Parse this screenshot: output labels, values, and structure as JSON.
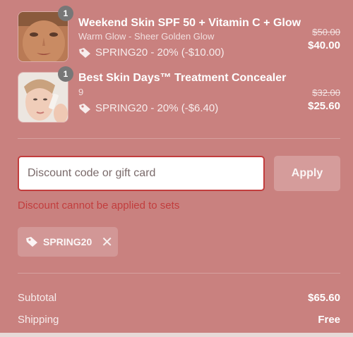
{
  "cart": {
    "items": [
      {
        "title": "Weekend Skin SPF 50 + Vitamin C + Glow",
        "variant": "Warm Glow - Sheer Golden Glow",
        "quantity": "1",
        "discount": "SPRING20 - 20% (-$10.00)",
        "original_price": "$50.00",
        "price": "$40.00",
        "thumbnail_icon": "face-closeup-image"
      },
      {
        "title": "Best Skin Days™ Treatment Concealer",
        "variant": "9",
        "quantity": "1",
        "discount": "SPRING20 - 20% (-$6.40)",
        "original_price": "$32.00",
        "price": "$25.60",
        "thumbnail_icon": "woman-applying-concealer-image"
      }
    ]
  },
  "discount_form": {
    "placeholder": "Discount code or gift card",
    "apply_label": "Apply",
    "error": "Discount cannot be applied to sets"
  },
  "applied_code": {
    "code": "SPRING20",
    "remove_glyph": "✕"
  },
  "totals": {
    "subtotal_label": "Subtotal",
    "subtotal_value": "$65.60",
    "shipping_label": "Shipping",
    "shipping_value": "Free"
  },
  "colors": {
    "background": "#c9817f",
    "error": "#c23d3d",
    "input_bg": "#ffffff"
  }
}
